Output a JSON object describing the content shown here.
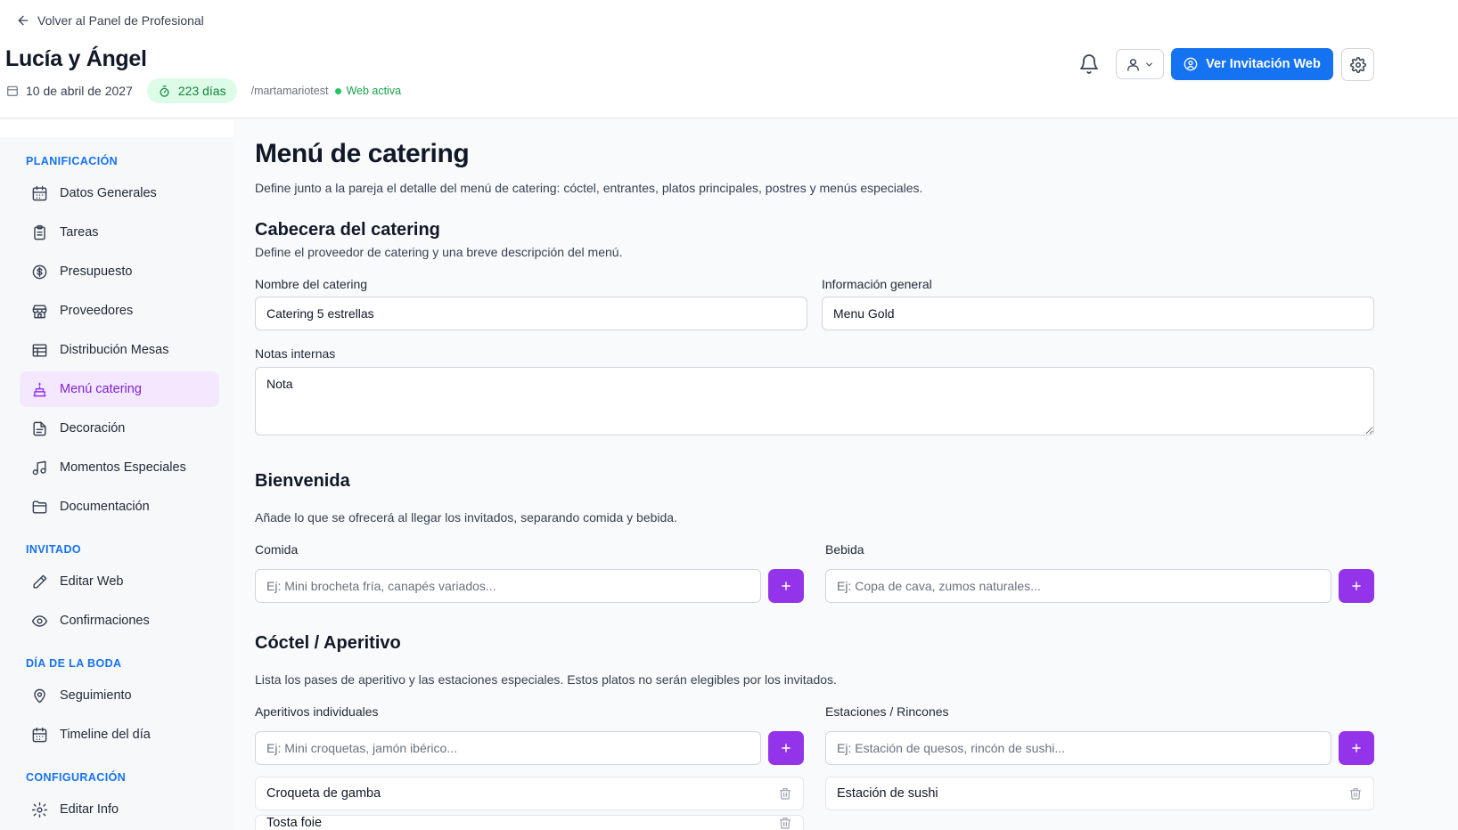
{
  "header": {
    "back_label": "Volver al Panel de Profesional",
    "couple_name": "Lucía y Ángel",
    "date": "10 de abril de 2027",
    "days_left": "223 días",
    "slug": "/martamariotest",
    "web_status": "Web activa",
    "view_web_label": "Ver Invitación Web"
  },
  "sidebar": {
    "sections": [
      {
        "title": "PLANIFICACIÓN",
        "items": [
          {
            "label": "Datos Generales",
            "icon": "calendar-icon"
          },
          {
            "label": "Tareas",
            "icon": "clipboard-icon"
          },
          {
            "label": "Presupuesto",
            "icon": "dollar-icon"
          },
          {
            "label": "Proveedores",
            "icon": "store-icon"
          },
          {
            "label": "Distribución Mesas",
            "icon": "table-icon"
          },
          {
            "label": "Menú catering",
            "icon": "cake-icon",
            "active": true
          },
          {
            "label": "Decoración",
            "icon": "file-icon"
          },
          {
            "label": "Momentos Especiales",
            "icon": "music-icon"
          },
          {
            "label": "Documentación",
            "icon": "folder-icon"
          }
        ]
      },
      {
        "title": "INVITADO",
        "items": [
          {
            "label": "Editar Web",
            "icon": "pencil-icon"
          },
          {
            "label": "Confirmaciones",
            "icon": "eye-icon"
          }
        ]
      },
      {
        "title": "DÍA DE LA BODA",
        "items": [
          {
            "label": "Seguimiento",
            "icon": "map-pin-icon"
          },
          {
            "label": "Timeline del día",
            "icon": "calendar-icon"
          }
        ]
      },
      {
        "title": "CONFIGURACIÓN",
        "items": [
          {
            "label": "Editar Info",
            "icon": "gear-icon"
          }
        ]
      }
    ]
  },
  "main": {
    "title": "Menú de catering",
    "description": "Define junto a la pareja el detalle del menú de catering: cóctel, entrantes, platos principales, postres y menús especiales.",
    "header_section": {
      "title": "Cabecera del catering",
      "description": "Define el proveedor de catering y una breve descripción del menú.",
      "name_label": "Nombre del catering",
      "name_value": "Catering 5 estrellas",
      "info_label": "Información general",
      "info_value": "Menu Gold",
      "notes_label": "Notas internas",
      "notes_value": "Nota"
    },
    "welcome": {
      "title": "Bienvenida",
      "description": "Añade lo que se ofrecerá al llegar los invitados, separando comida y bebida.",
      "food_label": "Comida",
      "food_placeholder": "Ej: Mini brocheta fría, canapés variados...",
      "drink_label": "Bebida",
      "drink_placeholder": "Ej: Copa de cava, zumos naturales..."
    },
    "cocktail": {
      "title": "Cóctel / Aperitivo",
      "description": "Lista los pases de aperitivo y las estaciones especiales. Estos platos no serán elegibles por los invitados.",
      "appetizers_label": "Aperitivos individuales",
      "appetizers_placeholder": "Ej: Mini croquetas, jamón ibérico...",
      "appetizers": [
        "Croqueta de gamba",
        "Tosta foie"
      ],
      "stations_label": "Estaciones / Rincones",
      "stations_placeholder": "Ej: Estación de quesos, rincón de sushi...",
      "stations": [
        "Estación de sushi"
      ]
    }
  },
  "colors": {
    "primary": "#1572f0",
    "accent_purple": "#9333ea",
    "active_bg": "#f3e8ff",
    "success": "#22c55e"
  }
}
